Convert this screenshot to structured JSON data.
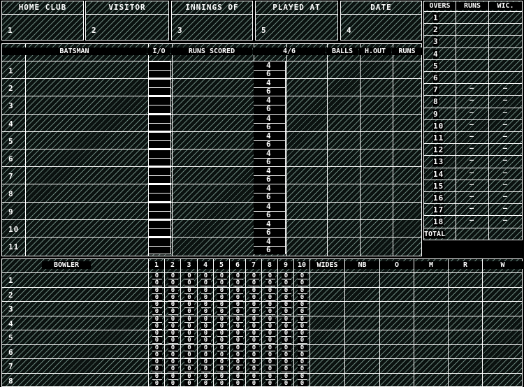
{
  "header": {
    "fields": [
      {
        "label": "HOME CLUB",
        "value": "1"
      },
      {
        "label": "VISITOR",
        "value": "2"
      },
      {
        "label": "INNINGS OF",
        "value": "3"
      },
      {
        "label": "PLAYED AT",
        "value": "5"
      },
      {
        "label": "DATE",
        "value": "4"
      }
    ]
  },
  "batting": {
    "columns": [
      "BATSMAN",
      "I/O",
      "RUNS SCORED",
      "4/6",
      "BALLS",
      "H.OUT",
      "RUNS"
    ],
    "rows": [
      "1",
      "2",
      "3",
      "4",
      "5",
      "6",
      "7",
      "8",
      "9",
      "10",
      "11"
    ],
    "four_label": "4",
    "six_label": "6"
  },
  "overs_panel": {
    "columns": [
      "OVERS",
      "RUNS",
      "WIC."
    ],
    "rows": [
      "1",
      "2",
      "3",
      "4",
      "5",
      "6",
      "7",
      "8",
      "9",
      "10",
      "11",
      "12",
      "13",
      "14",
      "15",
      "16",
      "17",
      "18"
    ],
    "total_label": "TOTAL",
    "dash": "–"
  },
  "bowling": {
    "columns": [
      "BOWLER",
      "1",
      "2",
      "3",
      "4",
      "5",
      "6",
      "7",
      "8",
      "9",
      "10",
      "WIDES",
      "NB",
      "O",
      "M",
      "R",
      "W"
    ],
    "rows": [
      "1",
      "2",
      "3",
      "4",
      "5",
      "6",
      "7",
      "8"
    ],
    "ball_mark": "0"
  },
  "colors": {
    "background": "#000000",
    "lines": "#ffffff",
    "hatch": "#78968c"
  }
}
